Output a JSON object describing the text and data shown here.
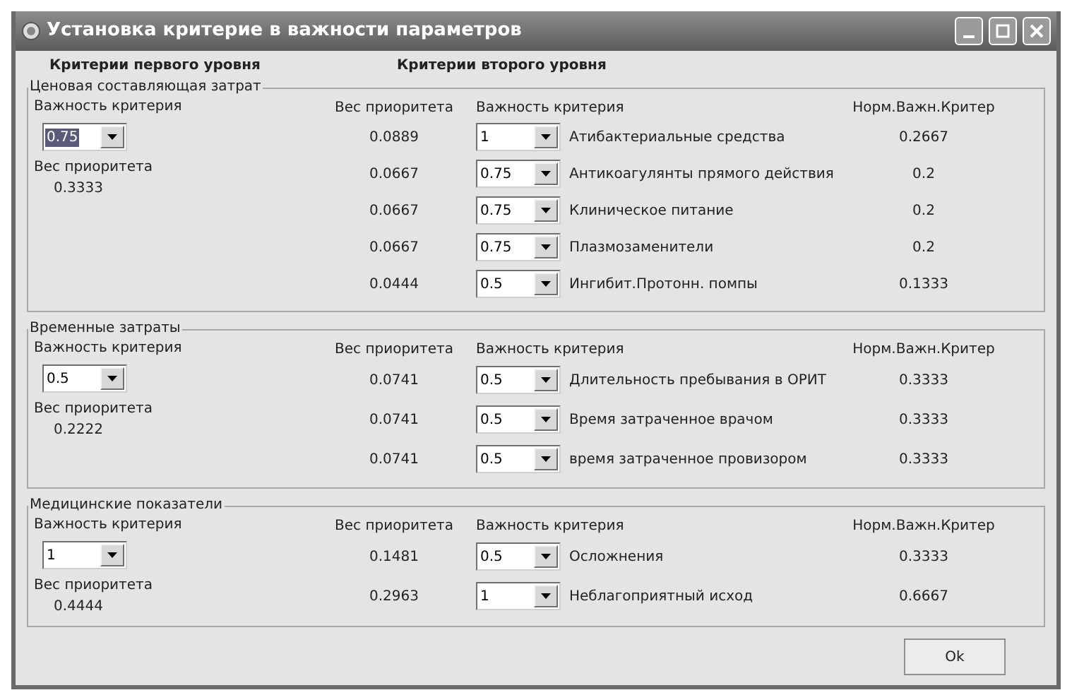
{
  "window": {
    "title": "Установка критерие в важности параметров"
  },
  "headings": [
    "Критерии первого уровня",
    "Критерии второго уровня"
  ],
  "groups": [
    {
      "title": "Ценовая составляющая затрат",
      "importance_label": "Важность критерия",
      "importance": {
        "value": "0.75",
        "highlighted": true
      },
      "priority_label": "Вес приоритета",
      "priority": "0.3333",
      "columns": [
        "Вес приоритета",
        "Важность критерия",
        "Норм.Важн.Критер"
      ],
      "rows": [
        {
          "priority": "0.0889",
          "importance": "1",
          "name": "Атибактериальные средства",
          "norm": "0.2667"
        },
        {
          "priority": "0.0667",
          "importance": "0.75",
          "name": "Антикоагулянты прямого действия",
          "norm": "0.2"
        },
        {
          "priority": "0.0667",
          "importance": "0.75",
          "name": "Клиническое питание",
          "norm": "0.2"
        },
        {
          "priority": "0.0667",
          "importance": "0.75",
          "name": "Плазмозаменители",
          "norm": "0.2"
        },
        {
          "priority": "0.0444",
          "importance": "0.5",
          "name": "Ингибит.Протонн. помпы",
          "norm": "0.1333"
        }
      ]
    },
    {
      "title": "Временные затраты",
      "importance_label": "Важность критерия",
      "importance": {
        "value": "0.5",
        "highlighted": false
      },
      "priority_label": "Вес приоритета",
      "priority": "0.2222",
      "columns": [
        "Вес приоритета",
        "Важность критерия",
        "Норм.Важн.Критер"
      ],
      "rows": [
        {
          "priority": "0.0741",
          "importance": "0.5",
          "name": "Длительность пребывания в ОРИТ",
          "norm": "0.3333"
        },
        {
          "priority": "0.0741",
          "importance": "0.5",
          "name": "Время затраченное врачом",
          "norm": "0.3333"
        },
        {
          "priority": "0.0741",
          "importance": "0.5",
          "name": "время затраченное провизором",
          "norm": "0.3333"
        }
      ]
    },
    {
      "title": "Медицинские показатели",
      "importance_label": "Важность критерия",
      "importance": {
        "value": "1",
        "highlighted": false
      },
      "priority_label": "Вес приоритета",
      "priority": "0.4444",
      "columns": [
        "Вес приоритета",
        "Важность критерия",
        "Норм.Важн.Критер"
      ],
      "rows": [
        {
          "priority": "0.1481",
          "importance": "0.5",
          "name": "Осложнения",
          "norm": "0.3333"
        },
        {
          "priority": "0.2963",
          "importance": "1",
          "name": "Неблагоприятный исход",
          "norm": "0.6667"
        }
      ]
    }
  ],
  "ok_button": "Ok"
}
